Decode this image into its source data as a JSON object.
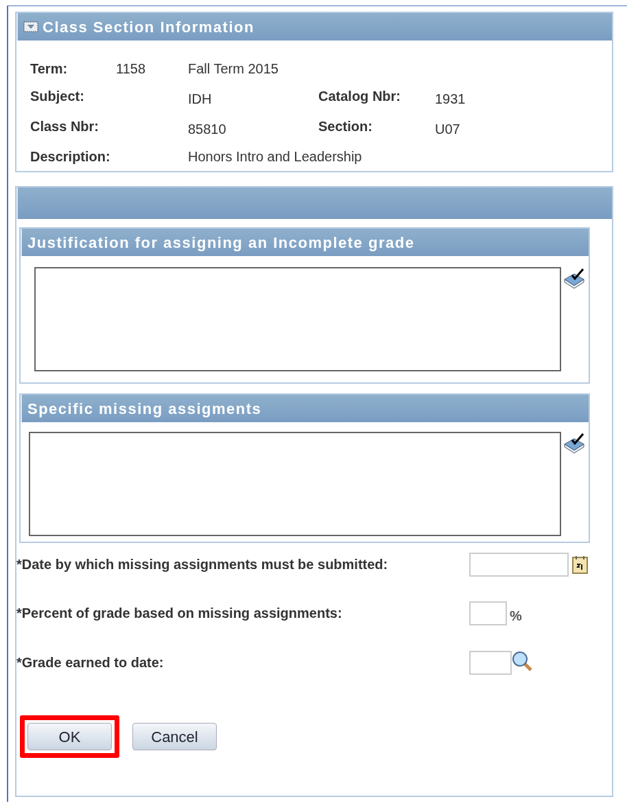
{
  "class_section": {
    "title": "Class Section Information",
    "fields": [
      {
        "label": "Term:",
        "value": "1158",
        "extra": "Fall Term 2015"
      },
      {
        "label": "Subject:",
        "value": "IDH",
        "label_2": "Catalog Nbr:",
        "value_2": "1931"
      },
      {
        "label": "Class Nbr:",
        "value": "85810",
        "label_2": "Section:",
        "value_2": "U07"
      },
      {
        "label": "Description:",
        "value": "Honors Intro and Leadership"
      }
    ]
  },
  "text_sections": [
    {
      "title": "Justification for assigning an Incomplete grade"
    },
    {
      "title": "Specific missing assigments"
    }
  ],
  "inputs": [
    {
      "label": "*Date by which missing assignments must be submitted:",
      "kind": "date"
    },
    {
      "label": "*Percent of grade based on missing assignments:",
      "kind": "percent",
      "suffix": "%"
    },
    {
      "label": "*Grade earned to date:",
      "kind": "lookup"
    }
  ],
  "buttons": [
    {
      "label": "OK",
      "highlighted": true
    },
    {
      "label": "Cancel",
      "highlighted": false
    }
  ]
}
